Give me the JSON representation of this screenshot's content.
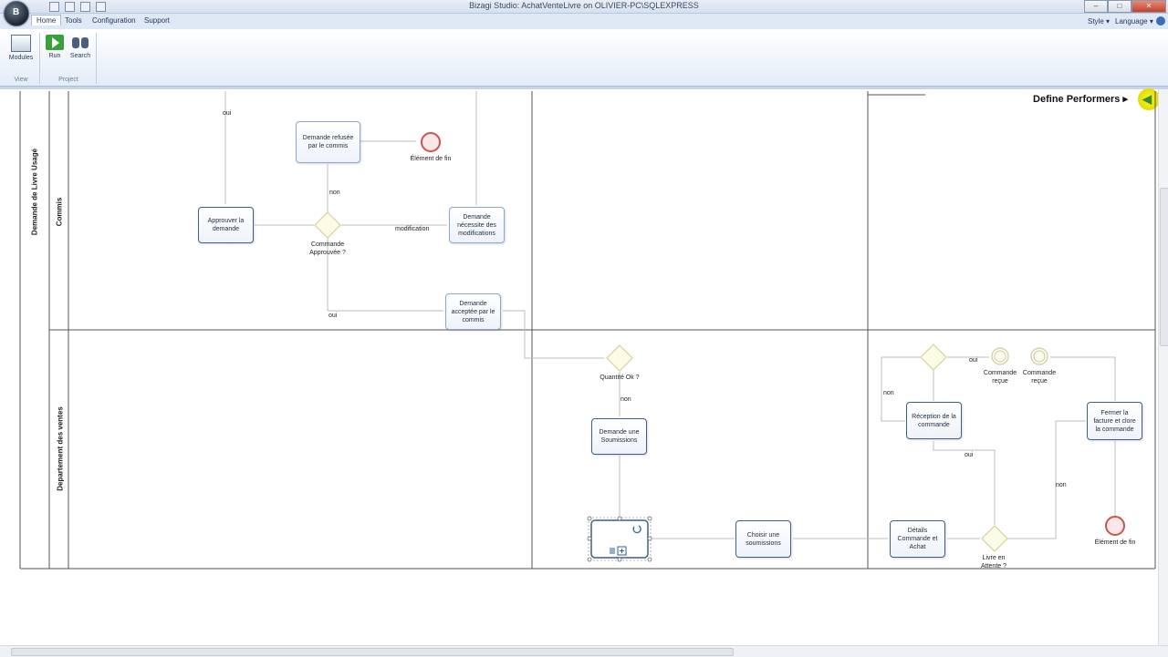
{
  "window": {
    "title": "Bizagi Studio: AchatVenteLivre on OLIVIER-PC\\SQLEXPRESS"
  },
  "tabs": [
    {
      "label": "Home",
      "active": true
    },
    {
      "label": "Tools"
    },
    {
      "label": "Configuration"
    },
    {
      "label": "Support"
    }
  ],
  "right_menu": {
    "style": "Style",
    "language": "Language"
  },
  "ribbon": {
    "buttons": {
      "modules": "Modules",
      "run": "Run",
      "search": "Search"
    },
    "groups": {
      "view": "View",
      "project": "Project"
    }
  },
  "wizard": {
    "step": "Define Performers"
  },
  "diagram": {
    "pool": "Demande de Livre Usagé",
    "lanes": {
      "commis": "Commis",
      "ventes": "Departement des ventes"
    },
    "tasks": {
      "approuver": "Approuver la demande",
      "refusee": "Demande refusée par le commis",
      "modifs": "Demande nécessite des modifications",
      "acceptee": "Demande acceptée par le commis",
      "soumissions": "Demande une Soumissions",
      "choisir": "Choisir une soumissions",
      "details": "Détails Commande et Achat",
      "reception": "Réception de la commande",
      "fermer": "Fermer la facture et clore la commande"
    },
    "gateways": {
      "approuvee": "Commande Approuvée ?",
      "quantite": "Quantité Ok ?",
      "attente": "Livre en Attente ?"
    },
    "events": {
      "fin1": "Élément de fin",
      "fin2": "Élément de fin",
      "recue1": "Commande reçue",
      "recue2": "Commande reçue"
    },
    "flow_labels": {
      "oui_top": "oui",
      "non_refus": "non",
      "modification": "modification",
      "oui_accept": "oui",
      "non_quantite": "non",
      "oui_recue": "oui",
      "non_recue": "non",
      "oui_attente": "oui",
      "non_attente": "non"
    }
  }
}
